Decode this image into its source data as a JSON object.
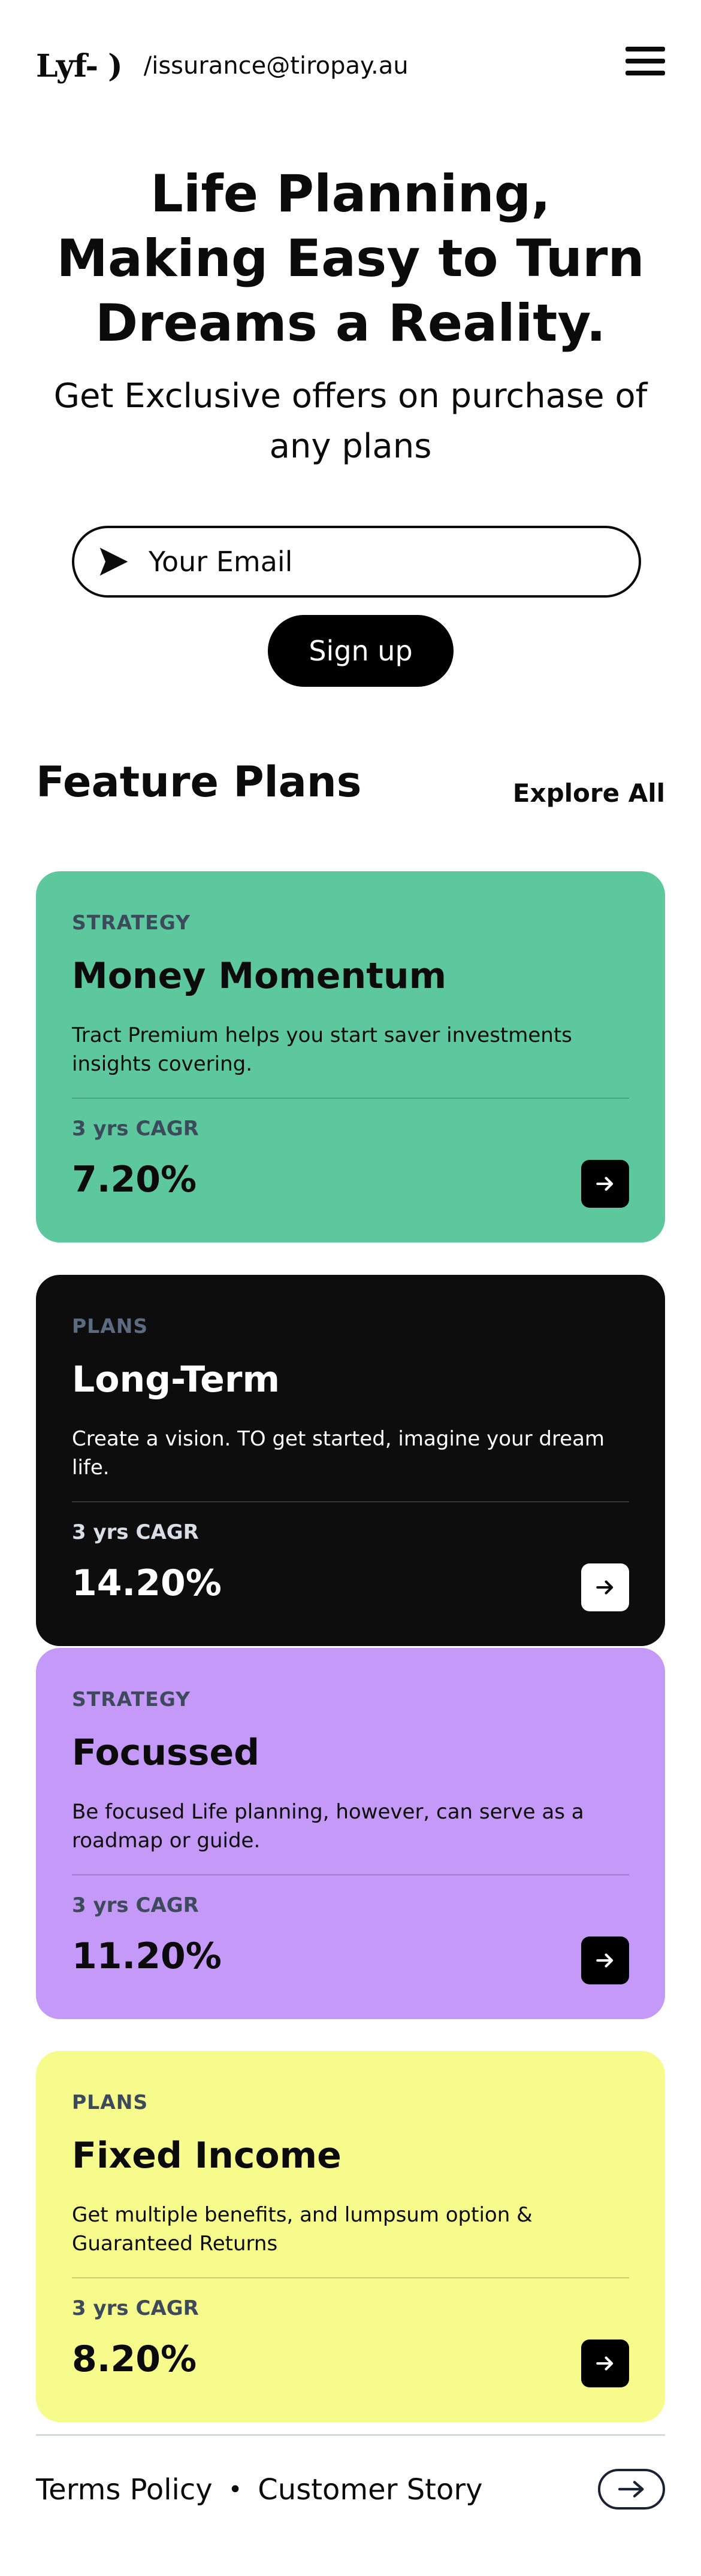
{
  "header": {
    "logo": "Lyf- )",
    "contact_email": "/issurance@tiropay.au",
    "menu_icon": "hamburger-menu-icon"
  },
  "hero": {
    "title": "Life Planning, Making Easy to Turn Dreams a Reality.",
    "subtitle": "Get Exclusive offers on purchase of any plans",
    "email_placeholder": "Your Email",
    "email_value": "",
    "send_icon": "paper-plane-icon",
    "signup_label": "Sign up"
  },
  "features": {
    "title": "Feature Plans",
    "explore_label": "Explore All",
    "cards": [
      {
        "tag": "STRATEGY",
        "name": "Money Momentum",
        "description": "Tract Premium helps you start saver investments insights covering.",
        "cagr_label": "3 yrs CAGR",
        "cagr_value": "7.20%",
        "color": "#5dc89e"
      },
      {
        "tag": "PLANS",
        "name": "Long-Term",
        "description": "Create a vision. TO get started, imagine your dream life.",
        "cagr_label": "3 yrs CAGR",
        "cagr_value": "14.20%",
        "color": "#0d0d0e"
      },
      {
        "tag": "STRATEGY",
        "name": "Focussed",
        "description": "Be focused Life planning, however, can serve as a roadmap or guide.",
        "cagr_label": "3 yrs CAGR",
        "cagr_value": "11.20%",
        "color": "#c599f7"
      },
      {
        "tag": "PLANS",
        "name": "Fixed Income",
        "description": "Get multiple benefits, and lumpsum option & Guaranteed Returns",
        "cagr_label": "3 yrs CAGR",
        "cagr_value": "8.20%",
        "color": "#f6fb8c"
      }
    ]
  },
  "footer": {
    "links": [
      "Terms Policy",
      "Customer Story"
    ],
    "separator": "•",
    "arrow_icon": "arrow-right-icon"
  }
}
